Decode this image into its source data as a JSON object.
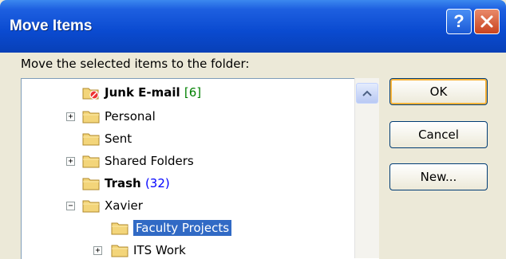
{
  "window": {
    "title": "Move Items",
    "help_label": "?"
  },
  "prompt": "Move the selected items to the folder:",
  "tree": {
    "items": [
      {
        "label": "Junk E-mail",
        "count": "[6]",
        "expander": "",
        "bold": true,
        "count_color": "green",
        "icon": "junk-folder-icon"
      },
      {
        "label": "Personal",
        "count": "",
        "expander": "+",
        "bold": false,
        "icon": "folder-icon"
      },
      {
        "label": "Sent",
        "count": "",
        "expander": "",
        "bold": false,
        "icon": "folder-icon"
      },
      {
        "label": "Shared Folders",
        "count": "",
        "expander": "+",
        "bold": false,
        "icon": "folder-icon"
      },
      {
        "label": "Trash",
        "count": "(32)",
        "expander": "",
        "bold": true,
        "count_color": "blue",
        "icon": "folder-icon"
      },
      {
        "label": "Xavier",
        "count": "",
        "expander": "−",
        "bold": false,
        "icon": "folder-icon"
      },
      {
        "label": "Faculty Projects",
        "count": "",
        "expander": "",
        "bold": false,
        "selected": true,
        "icon": "folder-icon"
      },
      {
        "label": "ITS Work",
        "count": "",
        "expander": "+",
        "bold": false,
        "icon": "folder-icon"
      }
    ]
  },
  "buttons": {
    "ok": "OK",
    "cancel": "Cancel",
    "new": "New..."
  },
  "colors": {
    "titlebar": "#0a4ad0",
    "selection": "#316ac5",
    "junk_count": "#008000",
    "trash_count": "#0000ff"
  }
}
